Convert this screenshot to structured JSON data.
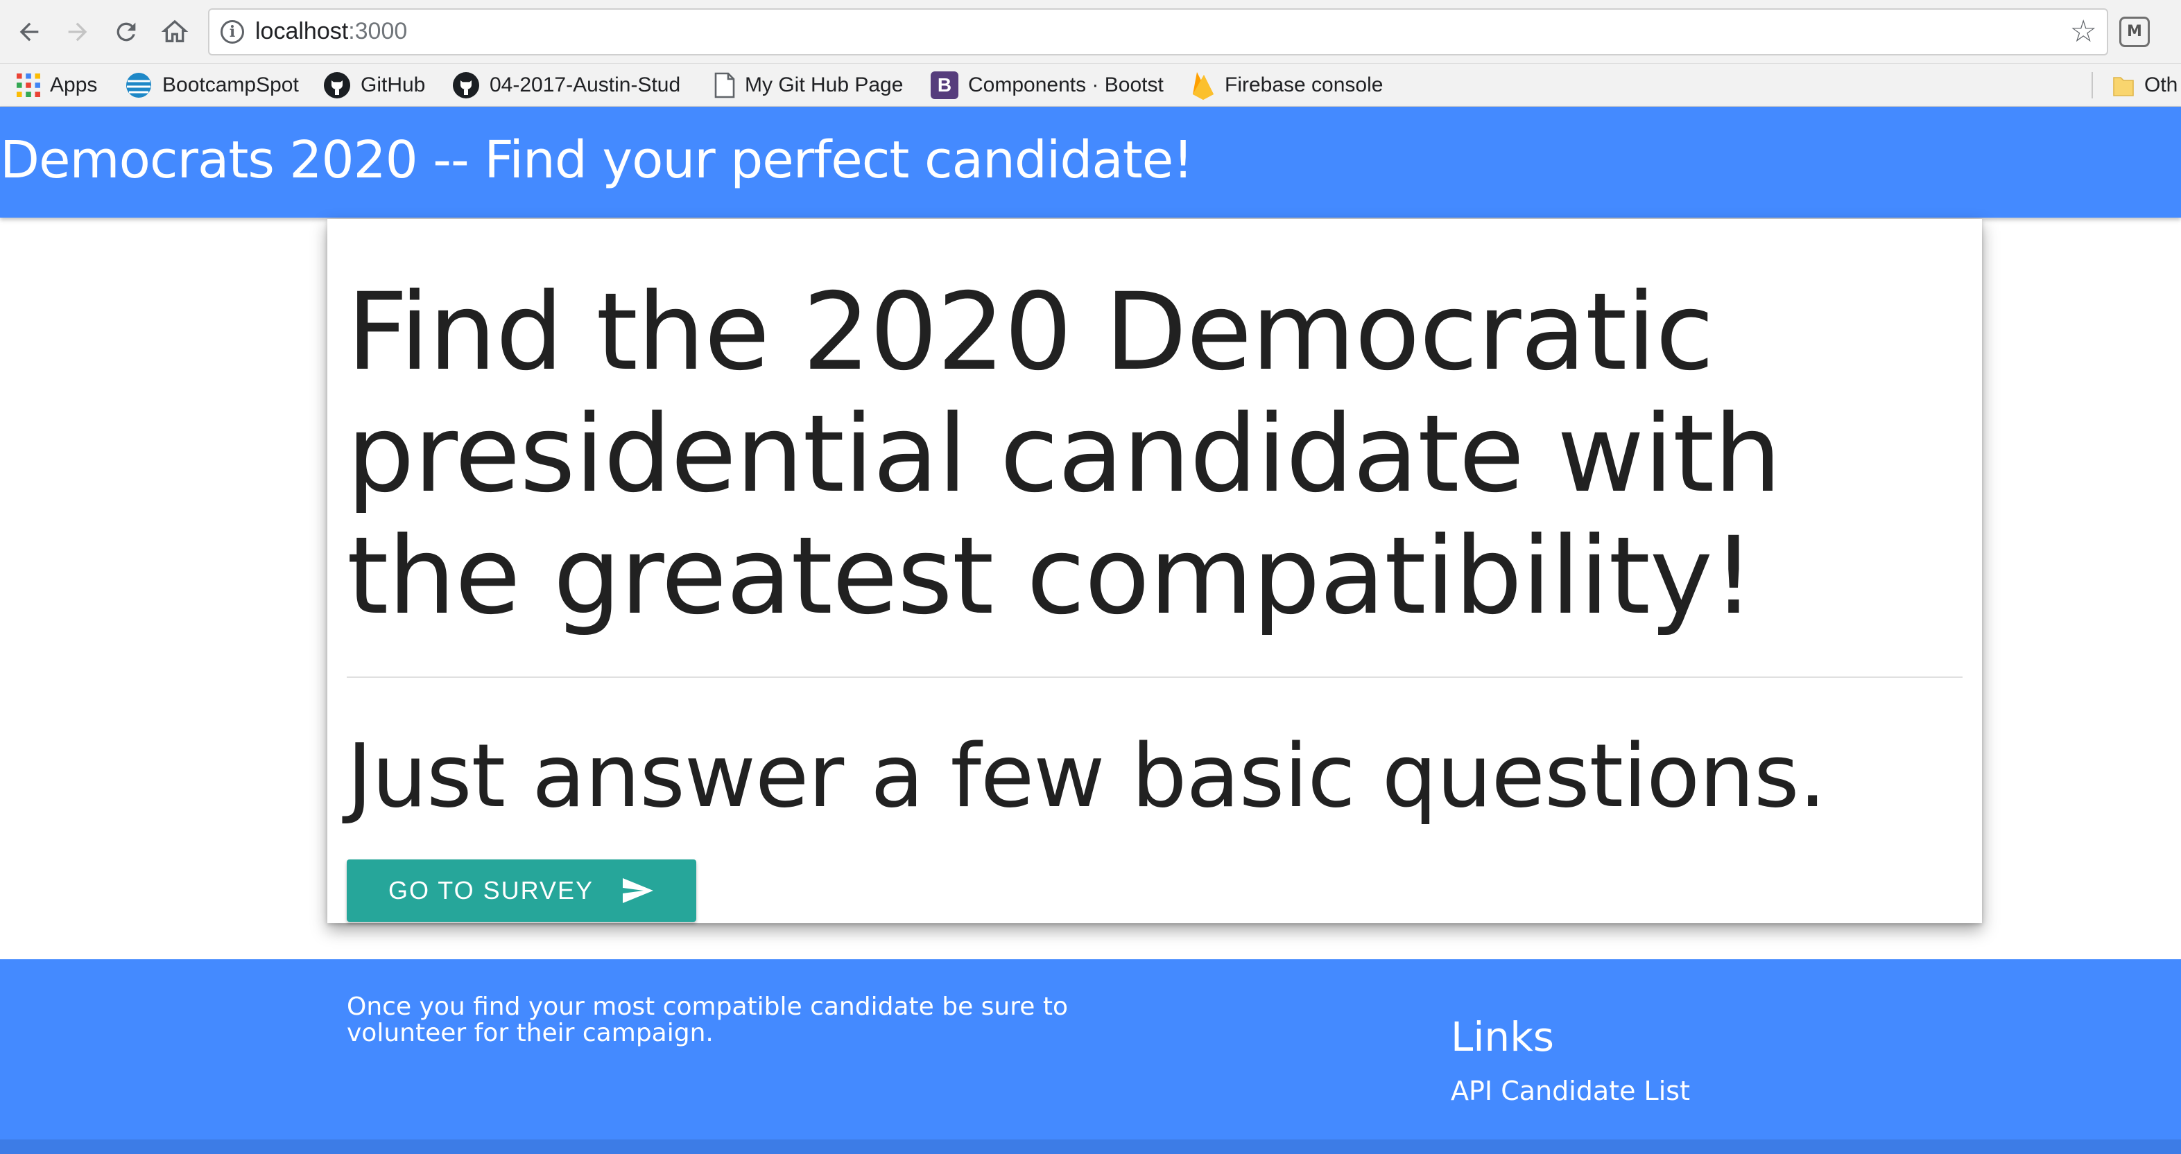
{
  "browser": {
    "url_host": "localhost",
    "url_port": ":3000",
    "bookmarks": [
      {
        "label": "Apps",
        "icon": "apps-grid-icon"
      },
      {
        "label": "BootcampSpot",
        "icon": "att-globe-icon"
      },
      {
        "label": "GitHub",
        "icon": "github-icon"
      },
      {
        "label": "04-2017-Austin-Stud",
        "icon": "github-icon"
      },
      {
        "label": "My Git Hub Page",
        "icon": "page-icon"
      },
      {
        "label": "Components · Bootst",
        "icon": "bootstrap-icon"
      },
      {
        "label": "Firebase console",
        "icon": "firebase-icon"
      },
      {
        "label": "Oth",
        "icon": "folder-icon"
      }
    ],
    "bootstrap_letter": "B",
    "extension_letter": "M"
  },
  "header": {
    "title": "Democrats 2020 -- Find your perfect candidate!"
  },
  "hero": {
    "headline": "Find the 2020 Democratic presidential candidate with the greatest compatibility!",
    "subheadline": "Just answer a few basic questions.",
    "button_label": "GO TO SURVEY"
  },
  "footer": {
    "text": "Once you find your most compatible candidate be sure to volunteer for their campaign.",
    "links_title": "Links",
    "links": [
      {
        "label": "API Candidate List"
      }
    ]
  },
  "colors": {
    "primary": "#448aff",
    "button": "#26a69a",
    "text": "#212121"
  }
}
